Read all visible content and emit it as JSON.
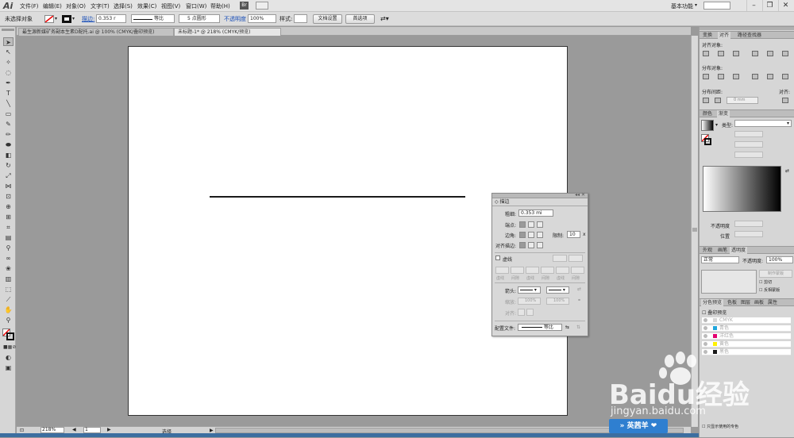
{
  "app": {
    "logo": "Ai",
    "menu": [
      "文件(F)",
      "编辑(E)",
      "对象(O)",
      "文字(T)",
      "选择(S)",
      "效果(C)",
      "视图(V)",
      "窗口(W)",
      "帮助(H)"
    ],
    "bridge": "Br",
    "workspace": "基本功能",
    "window_buttons": [
      "–",
      "❐",
      "✕"
    ]
  },
  "control_bar": {
    "no_selection": "未选择对象",
    "stroke_label": "描边:",
    "stroke_value": "0.353 r",
    "profile_label": "等比",
    "brush_label": "5 点圆形",
    "opacity_label": "不透明度",
    "opacity_value": "100%",
    "style_label": "样式:",
    "doc_setup": "文档设置",
    "preferences": "首选项"
  },
  "doc_tabs": [
    "最生源新媒矿务副本生素D配托.ai @ 100% (CMYK/叠印预览)",
    "未标题-1* @ 218% (CMYK/预览)"
  ],
  "stroke_panel": {
    "tab": "◇ 描边",
    "weight_label": "粗细:",
    "weight_value": "0.353 mi",
    "cap_label": "端点:",
    "corner_label": "边角:",
    "limit_label": "限制:",
    "limit_value": "10",
    "limit_unit": "x",
    "align_label": "对齐描边:",
    "dashed_label": "虚线",
    "dash_labels": [
      "虚线",
      "间隙",
      "虚线",
      "间隙",
      "虚线",
      "间隙"
    ],
    "arrow_label": "箭头:",
    "scale_label": "缩放:",
    "scale_a": "100%",
    "scale_b": "100%",
    "align_arrow_label": "对齐:",
    "profile_label": "配置文件:",
    "profile_value": "等比"
  },
  "right_panel": {
    "align_tabs": [
      "变换",
      "对齐",
      "路径查找器"
    ],
    "align_objects": "对齐对象:",
    "distribute_objects": "分布对象:",
    "distribute_spacing": "分布间距:",
    "spacing_value": "0 mm",
    "align_to": "对齐:",
    "gradient_tabs": [
      "颜色",
      "渐变"
    ],
    "type_label": "类型:",
    "opacity_label": "不透明度",
    "position_label": "位置",
    "transparency_tabs": [
      "外观",
      "画笔",
      "透明度"
    ],
    "blend_mode": "正常",
    "transparency_opacity_label": "不透明度:",
    "transparency_opacity_value": "100%",
    "make_mask": "制作蒙版",
    "clip": "剪切",
    "invert_mask": "反相蒙版",
    "separations_tabs": [
      "分色预览",
      "色板",
      "图层",
      "画板",
      "属性"
    ],
    "overprint_preview": "叠印预览",
    "separations": [
      {
        "name": "CMYK",
        "color": "#d8d8d8"
      },
      {
        "name": "青色",
        "color": "#21a6dc"
      },
      {
        "name": "洋红色",
        "color": "#e4006f"
      },
      {
        "name": "黄色",
        "color": "#fff100"
      },
      {
        "name": "黑色",
        "color": "#1a1a1a"
      }
    ],
    "spot_only": "只显示使用的专色"
  },
  "status_bar": {
    "zoom": "218%",
    "page": "1",
    "tool": "选择"
  },
  "watermark": {
    "brand": "Baidu经验",
    "url": "jingyan.baidu.com",
    "badge": "英茜羊"
  }
}
